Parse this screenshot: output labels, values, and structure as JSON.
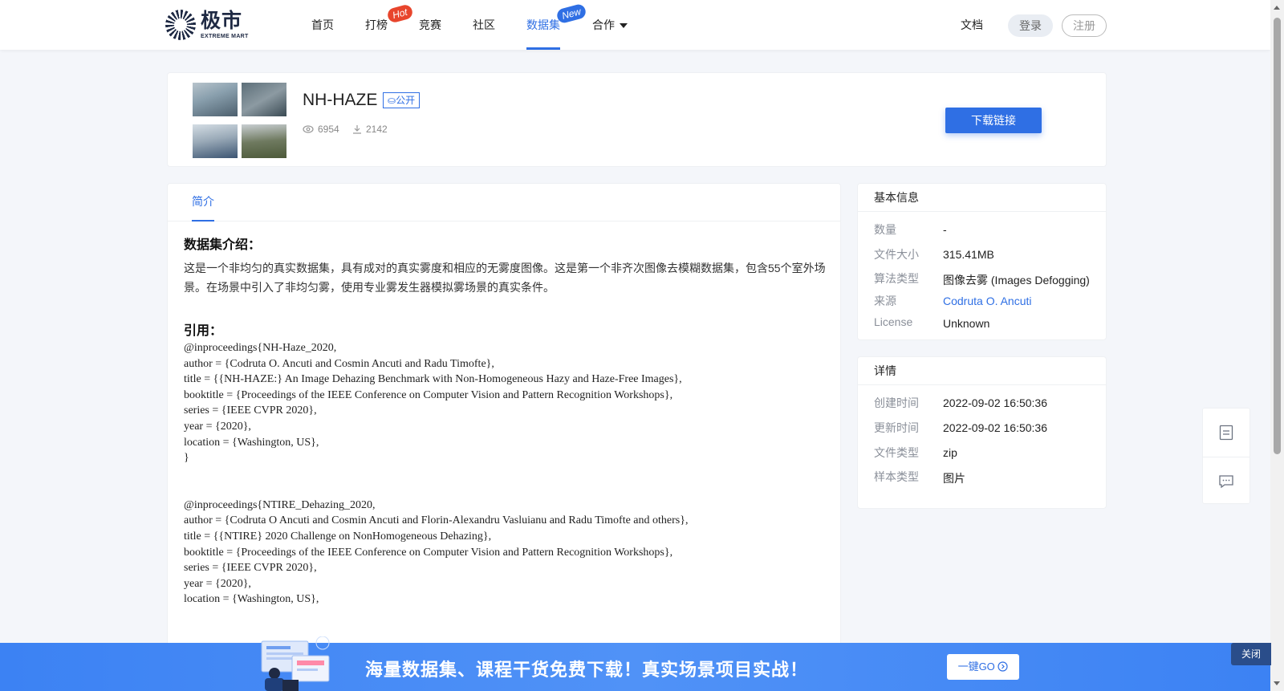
{
  "brand": {
    "name_cn": "极市",
    "name_en": "EXTREME MART"
  },
  "nav": {
    "items": [
      {
        "label": "首页"
      },
      {
        "label": "打榜",
        "badge": "Hot"
      },
      {
        "label": "竞赛"
      },
      {
        "label": "社区"
      },
      {
        "label": "数据集",
        "badge": "New",
        "active": true
      },
      {
        "label": "合作"
      }
    ],
    "docs": "文档",
    "login": "登录",
    "register": "注册"
  },
  "dataset": {
    "title": "NH-HAZE",
    "visibility": "公开",
    "views": "6954",
    "downloads": "2142",
    "download_button": "下载链接"
  },
  "tabs": {
    "intro": "简介"
  },
  "intro": {
    "heading": "数据集介绍：",
    "text": "这是一个非均匀的真实数据集，具有成对的真实雾度和相应的无雾度图像。这是第一个非齐次图像去模糊数据集，包含55个室外场景。在场景中引入了非均匀雾，使用专业雾发生器模拟雾场景的真实条件。",
    "citation_heading": "引用：",
    "citation1": [
      "@inproceedings{NH-Haze_2020,",
      "author = {Codruta O. Ancuti and Cosmin Ancuti and Radu Timofte},",
      "title = {{NH-HAZE:} An Image Dehazing Benchmark with Non-Homogeneous Hazy and Haze-Free Images},",
      "booktitle =  {Proceedings of the IEEE Conference on Computer Vision and Pattern Recognition Workshops},",
      "series = {IEEE CVPR 2020},",
      "year = {2020},",
      "location = {Washington, US},",
      "}"
    ],
    "citation2": [
      "@inproceedings{NTIRE_Dehazing_2020,",
      "author = {Codruta O Ancuti and Cosmin Ancuti and Florin-Alexandru Vasluianu and Radu Timofte and others},",
      "title = {{NTIRE} 2020 Challenge on NonHomogeneous Dehazing},",
      "booktitle =  {Proceedings of the IEEE Conference on Computer Vision and Pattern Recognition Workshops},",
      "series = {IEEE CVPR 2020},",
      "year = {2020},",
      "location = {Washington, US},"
    ]
  },
  "basic_info": {
    "title": "基本信息",
    "rows": [
      {
        "key": "数量",
        "value": "-"
      },
      {
        "key": "文件大小",
        "value": "315.41MB"
      },
      {
        "key": "算法类型",
        "value": "图像去雾 (Images Defogging)"
      },
      {
        "key": "来源",
        "value": "Codruta O. Ancuti"
      },
      {
        "key": "License",
        "value": "Unknown"
      }
    ]
  },
  "details": {
    "title": "详情",
    "rows": [
      {
        "key": "创建时间",
        "value": "2022-09-02 16:50:36"
      },
      {
        "key": "更新时间",
        "value": "2022-09-02 16:50:36"
      },
      {
        "key": "文件类型",
        "value": "zip"
      },
      {
        "key": "样本类型",
        "value": "图片"
      }
    ]
  },
  "banner": {
    "text": "海量数据集、课程干货免费下载！真实场景项目实战！",
    "go_button": "一键GO",
    "close": "关闭"
  },
  "colors": {
    "accent": "#2f6fe4",
    "hot": "#e8452c",
    "banner": "#4a8cf5"
  },
  "icons": [
    "eye-icon",
    "download-icon",
    "note-icon",
    "comment-icon",
    "chevron-right-icon"
  ]
}
